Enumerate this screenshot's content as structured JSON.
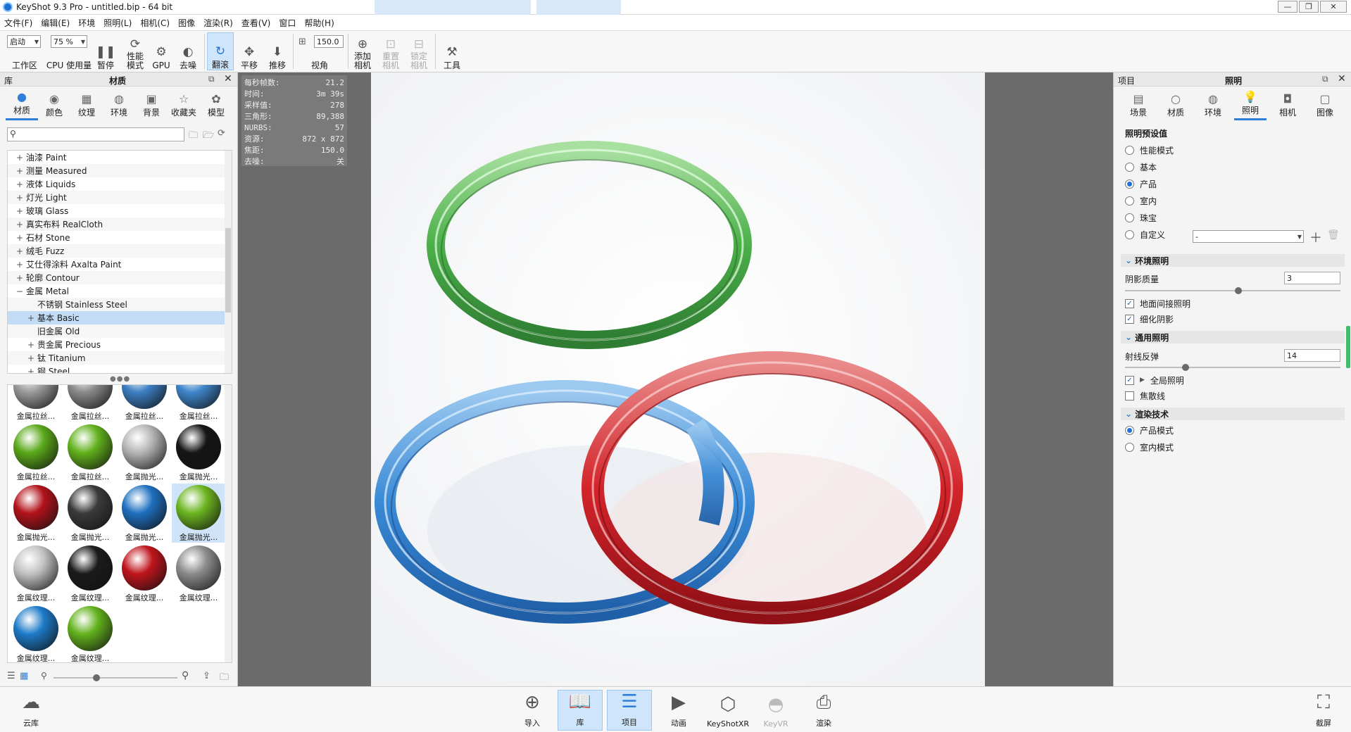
{
  "window": {
    "title": "KeyShot 9.3 Pro  - untitled.bip  - 64 bit"
  },
  "menu": [
    "文件(F)",
    "编辑(E)",
    "环境",
    "照明(L)",
    "相机(C)",
    "图像",
    "渲染(R)",
    "查看(V)",
    "窗口",
    "帮助(H)"
  ],
  "toolbar": {
    "workspace_value": "启动",
    "workspace_label": "工作区",
    "cpu_value": "75 %",
    "cpu_label": "CPU 使用量",
    "pause": "暂停",
    "perf_mode": "性能模式",
    "gpu": "GPU",
    "denoise": "去噪",
    "tumble": "翻滚",
    "pan": "平移",
    "dolly": "推移",
    "fov_value": "150.0",
    "fov_label": "视角",
    "add_camera": "添加相机",
    "reset_camera": "重置相机",
    "lock_camera": "锁定相机",
    "tools": "工具"
  },
  "library": {
    "panel_title_left": "库",
    "panel_title": "材质",
    "tabs": [
      "材质",
      "颜色",
      "纹理",
      "环境",
      "背景",
      "收藏夹",
      "模型"
    ],
    "active_tab": "材质",
    "search_placeholder": "",
    "tree": [
      {
        "pm": "+",
        "label": "油漆 Paint"
      },
      {
        "pm": "+",
        "label": "测量 Measured"
      },
      {
        "pm": "+",
        "label": "液体 Liquids"
      },
      {
        "pm": "+",
        "label": "灯光 Light"
      },
      {
        "pm": "+",
        "label": "玻璃 Glass"
      },
      {
        "pm": "+",
        "label": "真实布料 RealCloth"
      },
      {
        "pm": "+",
        "label": "石材 Stone"
      },
      {
        "pm": "+",
        "label": "绒毛 Fuzz"
      },
      {
        "pm": "+",
        "label": "艾仕得涂料 Axalta Paint"
      },
      {
        "pm": "+",
        "label": "轮廓 Contour"
      },
      {
        "pm": "−",
        "label": "金属 Metal"
      },
      {
        "pm": "",
        "label": "不锈钢 Stainless Steel"
      },
      {
        "pm": "+",
        "label": "基本 Basic"
      },
      {
        "pm": "",
        "label": "旧金属 Old"
      },
      {
        "pm": "+",
        "label": "贵金属 Precious"
      },
      {
        "pm": "+",
        "label": "钛 Titanium"
      },
      {
        "pm": "+",
        "label": "钢 Steel"
      }
    ],
    "thumbnails": [
      {
        "label": "金属拉丝...",
        "color": "#9a9a9a"
      },
      {
        "label": "金属拉丝...",
        "color": "#8a8a8a"
      },
      {
        "label": "金属拉丝...",
        "color": "#3b7fc4"
      },
      {
        "label": "金属拉丝...",
        "color": "#3f86cc"
      },
      {
        "label": "金属拉丝...",
        "color": "#5aa81a"
      },
      {
        "label": "金属拉丝...",
        "color": "#62b11c"
      },
      {
        "label": "金属抛光...",
        "color": "#b5b5b5"
      },
      {
        "label": "金属抛光...",
        "color": "#151515"
      },
      {
        "label": "金属抛光...",
        "color": "#b3121a"
      },
      {
        "label": "金属抛光...",
        "color": "#3a3a3a"
      },
      {
        "label": "金属抛光...",
        "color": "#1e70c0"
      },
      {
        "label": "金属抛光...",
        "color": "#6cb520"
      },
      {
        "label": "金属纹理...",
        "color": "#c2c2c2"
      },
      {
        "label": "金属纹理...",
        "color": "#1b1b1b"
      },
      {
        "label": "金属纹理...",
        "color": "#c0141c"
      },
      {
        "label": "金属纹理...",
        "color": "#8c8c8c"
      },
      {
        "label": "金属纹理...",
        "color": "#1d7ac8"
      },
      {
        "label": "金属纹理...",
        "color": "#62b11c"
      }
    ]
  },
  "hud": [
    {
      "k": "每秒帧数:",
      "v": "21.2"
    },
    {
      "k": "时间:",
      "v": "3m 39s"
    },
    {
      "k": "采样值:",
      "v": "278"
    },
    {
      "k": "三角形:",
      "v": "89,388"
    },
    {
      "k": "NURBS:",
      "v": "57"
    },
    {
      "k": "资源:",
      "v": "872 x 872"
    },
    {
      "k": "焦距:",
      "v": "150.0"
    },
    {
      "k": "去噪:",
      "v": "关"
    }
  ],
  "project": {
    "panel_title_left": "项目",
    "panel_title": "照明",
    "tabs": [
      "场景",
      "材质",
      "环境",
      "照明",
      "相机",
      "图像"
    ],
    "active_tab": "照明",
    "preset_title": "照明预设值",
    "presets": [
      {
        "label": "性能模式",
        "on": false
      },
      {
        "label": "基本",
        "on": false
      },
      {
        "label": "产品",
        "on": true
      },
      {
        "label": "室内",
        "on": false
      },
      {
        "label": "珠宝",
        "on": false
      },
      {
        "label": "自定义",
        "on": false
      }
    ],
    "custom_select": "-",
    "env_section": "环境照明",
    "shadow_quality_label": "阴影质量",
    "shadow_quality_value": "3",
    "shadow_quality_fraction": 0.52,
    "ground_indirect": "地面间接照明",
    "fine_shadows": "细化阴影",
    "general_section": "通用照明",
    "ray_bounce_label": "射线反弹",
    "ray_bounce_value": "14",
    "ray_bounce_fraction": 0.27,
    "global_illum": "全局照明",
    "caustics": "焦散线",
    "render_section": "渲染技术",
    "render_modes": [
      {
        "label": "产品模式",
        "on": true
      },
      {
        "label": "室内模式",
        "on": false
      }
    ]
  },
  "bottom": {
    "cloud": "云库",
    "import": "导入",
    "library": "库",
    "project": "项目",
    "animation": "动画",
    "keyshotxr": "KeyShotXR",
    "keyvr": "KeyVR",
    "render": "渲染",
    "screenshot": "截屏"
  },
  "colors": {
    "accent": "#2f7fd9",
    "ring_green": "#5cb85c",
    "ring_blue": "#3f8fd9",
    "ring_red": "#d92a2a"
  }
}
